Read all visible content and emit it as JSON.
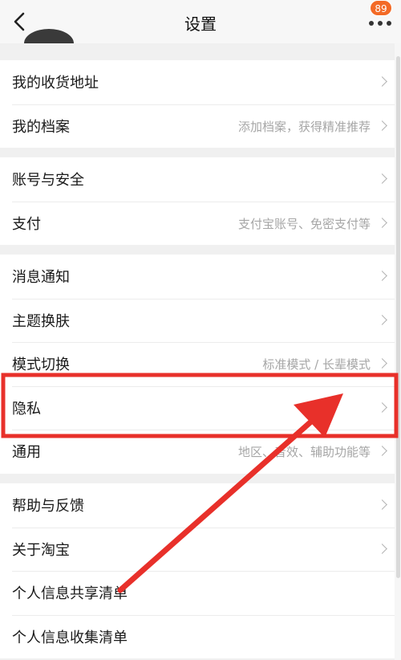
{
  "header": {
    "title": "设置",
    "back_icon": "chevron-left-icon",
    "more_icon": "more-dots-icon",
    "badge_count": "89",
    "badge_color": "#f36a26"
  },
  "groups": [
    {
      "rows": [
        {
          "label": "我的收货地址",
          "value": ""
        },
        {
          "label": "我的档案",
          "value": "添加档案，获得精准推荐"
        }
      ]
    },
    {
      "rows": [
        {
          "label": "账号与安全",
          "value": ""
        },
        {
          "label": "支付",
          "value": "支付宝账号、免密支付等"
        }
      ]
    },
    {
      "rows": [
        {
          "label": "消息通知",
          "value": ""
        },
        {
          "label": "主题换肤",
          "value": ""
        },
        {
          "label": "模式切换",
          "value": "标准模式 / 长辈模式"
        },
        {
          "label": "隐私",
          "value": ""
        },
        {
          "label": "通用",
          "value": "地区、音效、辅助功能等"
        }
      ]
    },
    {
      "rows": [
        {
          "label": "帮助与反馈",
          "value": ""
        },
        {
          "label": "关于淘宝",
          "value": ""
        },
        {
          "label": "个人信息共享清单",
          "value": ""
        },
        {
          "label": "个人信息收集清单",
          "value": ""
        }
      ]
    }
  ],
  "annotation": {
    "highlight_color": "#e8302a",
    "highlighted_item": "隐私"
  }
}
